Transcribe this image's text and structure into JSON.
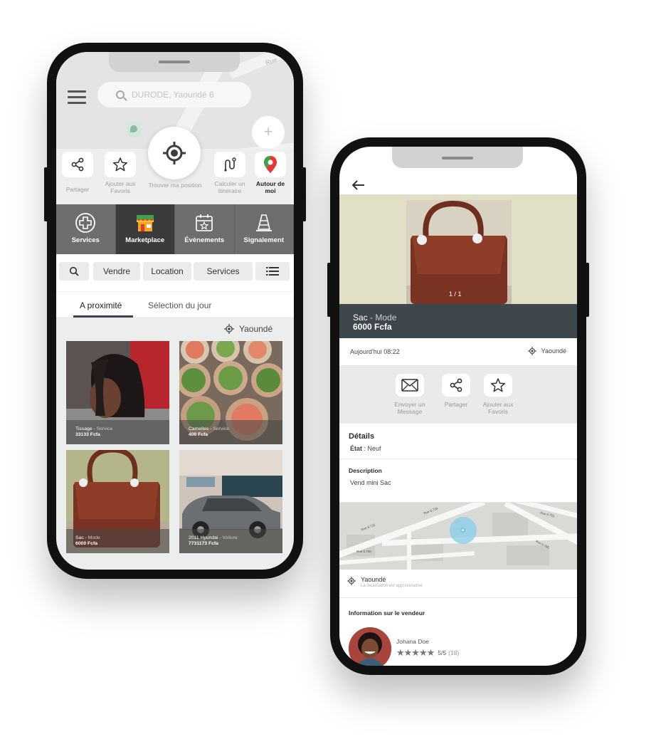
{
  "phone1": {
    "search": {
      "placeholder": "DURODE, Yaoundé 6"
    },
    "map": {
      "street": "Rue"
    },
    "actions": {
      "share": "Partager",
      "favorites": "Ajouter aux Favoris",
      "find_position": "Trouver ma position",
      "route": "Calculer un itinéraire",
      "around_me": "Autour de moi"
    },
    "categories": [
      {
        "label": "Services",
        "icon": "plus-circle-icon"
      },
      {
        "label": "Marketplace",
        "icon": "shop-icon"
      },
      {
        "label": "Évènements",
        "icon": "calendar-star-icon"
      },
      {
        "label": "Signalement",
        "icon": "cone-icon"
      }
    ],
    "active_category": "Marketplace",
    "filters": {
      "search_icon": "search-icon",
      "sell": "Vendre",
      "rent": "Location",
      "services": "Services",
      "list_icon": "list-icon"
    },
    "tabs": {
      "nearby": "A proximité",
      "daily_selection": "Sélection du jour"
    },
    "location": "Yaoundé",
    "items": [
      {
        "name": "Tissage",
        "category": "Service",
        "price": "33133 Fcfa"
      },
      {
        "name": "Camelles",
        "category": "Service",
        "price": "400 Fcfa"
      },
      {
        "name": "Sac",
        "category": "Mode",
        "price": "6000 Fcfa"
      },
      {
        "name": "2011 Hyundai",
        "category": "Voiture",
        "price": "7731173 Fcfa"
      }
    ]
  },
  "phone2": {
    "photo_counter": "1 / 1",
    "product": {
      "name": "Sac",
      "category": "Mode",
      "price": "6000 Fcfa"
    },
    "date": "Aujourd'hui 08:22",
    "location": "Yaoundé",
    "actions": {
      "message": "Envoyer un Message",
      "share": "Partager",
      "favorites": "Ajouter aux Favoris"
    },
    "details": {
      "title": "Détails",
      "state_label": "État",
      "state_value": "Neuf"
    },
    "description": {
      "title": "Description",
      "text": "Vend mini Sac"
    },
    "map": {
      "street_labels": [
        "Rue 6.729",
        "Rue 6.732",
        "Rue 6.730",
        "Rue 6.745",
        "Rue 6.751"
      ]
    },
    "map_location": {
      "city": "Yaoundé",
      "note": "La localisation est approximative"
    },
    "seller": {
      "title": "Information sur le vendeur",
      "name": "Johana Doe",
      "stars": 5,
      "score": "5/5",
      "count": "(18)"
    }
  },
  "colors": {
    "dark_band": "#3e474c",
    "category_bg": "#6e6e6e",
    "category_active": "#3b3b3b",
    "accent_green": "#3fa14a",
    "accent_red": "#e53935"
  }
}
